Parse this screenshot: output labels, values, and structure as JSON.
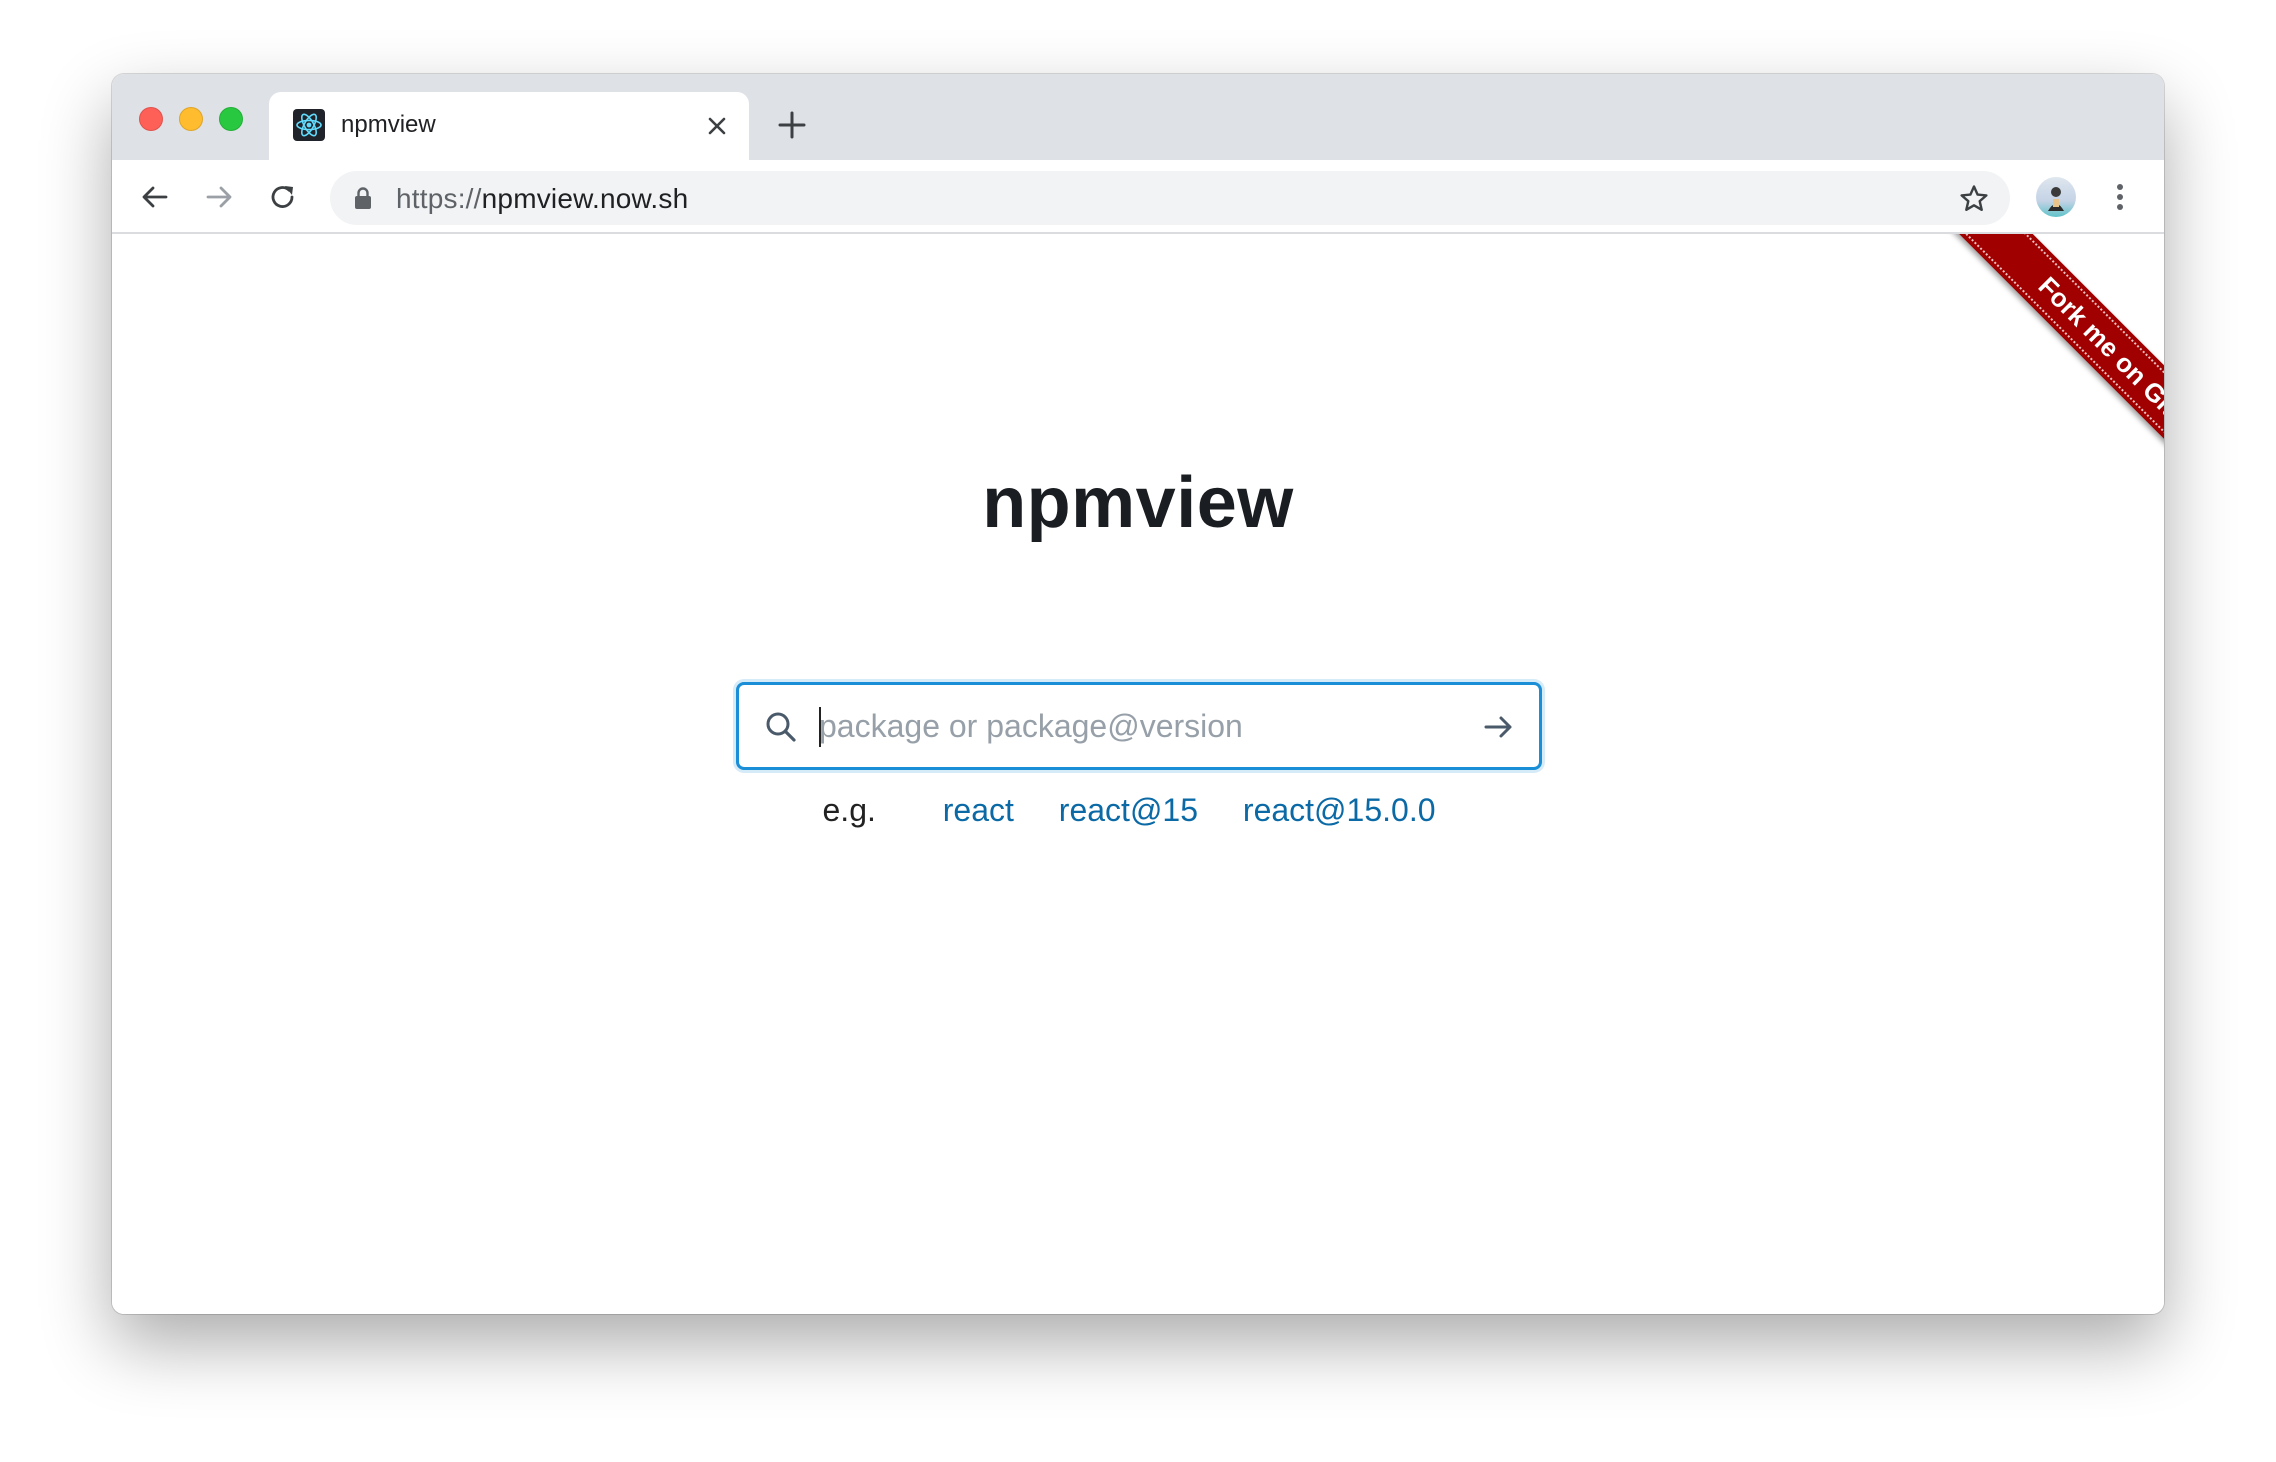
{
  "browser": {
    "tab": {
      "title": "npmview"
    },
    "address_bar": {
      "scheme": "https://",
      "host": "npmview.now.sh"
    }
  },
  "page": {
    "ribbon_text": "Fork me on GitHub",
    "title": "npmview",
    "search": {
      "placeholder": "package or package@version",
      "value": ""
    },
    "examples": {
      "prefix": "e.g.",
      "items": [
        "react",
        "react@15",
        "react@15.0.0"
      ]
    }
  },
  "colors": {
    "accent": "#1a8ed6",
    "link": "#0b6aa6",
    "ribbon": "#a00000"
  },
  "icons": {
    "tab_favicon": "react-logo-icon",
    "tab_close": "close-icon",
    "new_tab": "plus-icon",
    "back": "arrow-left-icon",
    "forward": "arrow-right-icon",
    "reload": "reload-icon",
    "lock": "lock-icon",
    "bookmark": "star-icon",
    "menu": "kebab-menu-icon",
    "search": "search-icon",
    "submit": "arrow-right-icon"
  }
}
